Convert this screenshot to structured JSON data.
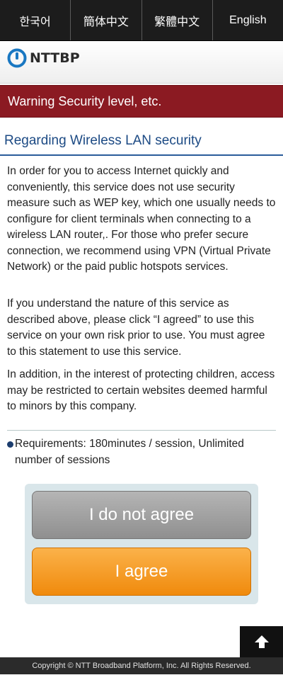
{
  "languages": [
    "한국어",
    "簡体中文",
    "繁體中文",
    "English"
  ],
  "logo_text": "NTTBP",
  "warning_title": "Warning Security level, etc.",
  "section_title": "Regarding Wireless LAN security",
  "paragraphs": [
    "In order for you to access Internet quickly and conveniently, this service does not use security measure such as WEP key, which one usually needs to configure for client terminals when connecting to a wireless LAN router,. For those who prefer secure connection, we recommend using VPN (Virtual Private Network) or the paid public hotspots services.",
    "If you understand the nature of this service as described above, please click “I agreed” to use this service on your own risk prior to use. You must agree to this statement to use this service.",
    "In addition, in the interest of protecting children, access may be restricted to certain websites deemed harmful to minors by this company."
  ],
  "requirements": "Requirements: 180minutes / session, Unlimited number of sessions",
  "buttons": {
    "disagree": "I do not agree",
    "agree": "I agree"
  },
  "footer": "Copyright © NTT Broadband Platform, Inc. All Rights Reserved.",
  "icons": {
    "logo_mark": "nttbp-logo-icon",
    "back_to_top": "arrow-up-icon"
  },
  "colors": {
    "warning_bar": "#8b1a22",
    "section_title": "#1c4a84",
    "agree_button": "#f39313",
    "disagree_button": "#9f9f9f"
  }
}
